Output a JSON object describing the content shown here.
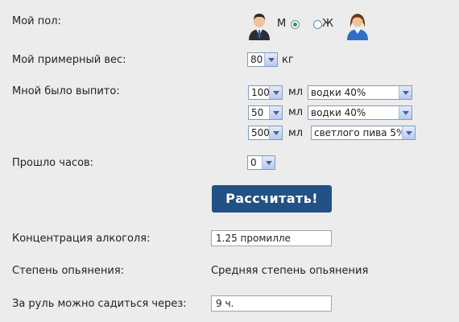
{
  "gender": {
    "label": "Мой пол:",
    "male_label": "М",
    "female_label": "Ж",
    "selected": "male",
    "male_icon": "male-user-icon",
    "female_icon": "female-user-icon"
  },
  "weight": {
    "label": "Мой примерный вес:",
    "value": "80",
    "unit": "кг"
  },
  "drinks": {
    "label": "Мной было выпито:",
    "rows": [
      {
        "amount": "100",
        "unit": "мл",
        "type": "водки 40%"
      },
      {
        "amount": "50",
        "unit": "мл",
        "type": "водки 40%"
      },
      {
        "amount": "500",
        "unit": "мл",
        "type": "светлого пива 5%"
      }
    ]
  },
  "hours": {
    "label": "Прошло часов:",
    "value": "0"
  },
  "calculate_label": "Рассчитать!",
  "results": {
    "concentration_label": "Концентрация алкоголя:",
    "concentration_value": "1.25 промилле",
    "degree_label": "Степень опьянения:",
    "degree_value": "Средняя степень опьянения",
    "drive_label": "За руль можно садиться через:",
    "drive_value": "9 ч."
  },
  "colors": {
    "button": "#225186",
    "background": "#ececec"
  }
}
